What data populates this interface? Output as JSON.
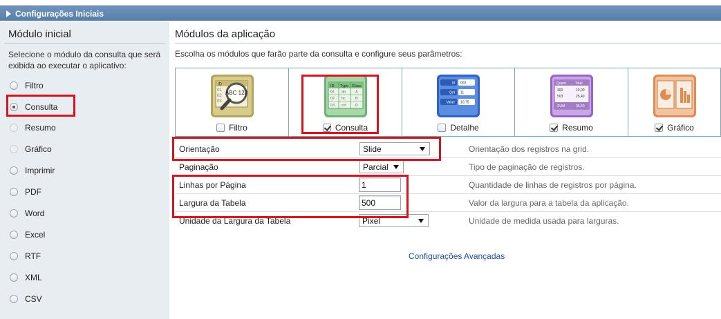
{
  "header": {
    "title": "Configurações Iniciais"
  },
  "sidebar": {
    "title": "Módulo inicial",
    "description": "Selecione o módulo da consulta que será exibida ao executar o aplicativo:",
    "options": [
      {
        "label": "Filtro",
        "state": "enabled"
      },
      {
        "label": "Consulta",
        "state": "checked"
      },
      {
        "label": "Resumo",
        "state": "disabled"
      },
      {
        "label": "Gráfico",
        "state": "disabled"
      },
      {
        "label": "Imprimir",
        "state": "enabled"
      },
      {
        "label": "PDF",
        "state": "enabled"
      },
      {
        "label": "Word",
        "state": "enabled"
      },
      {
        "label": "Excel",
        "state": "enabled"
      },
      {
        "label": "RTF",
        "state": "enabled"
      },
      {
        "label": "XML",
        "state": "enabled"
      },
      {
        "label": "CSV",
        "state": "enabled"
      }
    ]
  },
  "main": {
    "title": "Módulos da aplicação",
    "description": "Escolha os módulos que farão parte da consulta e configure seus parâmetros:",
    "modules": [
      {
        "label": "Filtro",
        "checked": false,
        "icon": "filter-icon",
        "icon_text": {
          "h1": "ID",
          "c1": "01",
          "c2": "02",
          "c3": "03",
          "magnifier": "ABC 123"
        }
      },
      {
        "label": "Consulta",
        "checked": true,
        "icon": "grid-icon",
        "icon_text": {
          "h1": "ID",
          "h2": "Type",
          "h3": "Class",
          "r1": [
            "01",
            "ab",
            "A"
          ],
          "r2": [
            "02",
            "bc",
            "B"
          ],
          "r3": [
            "03",
            "cd",
            "D"
          ]
        }
      },
      {
        "label": "Detalhe",
        "checked": false,
        "icon": "detail-icon",
        "icon_text": {
          "l1": "Id",
          "v1": "002",
          "l2": "Qnt",
          "v2": "11",
          "l3": "Value",
          "v3": "10,75"
        }
      },
      {
        "label": "Resumo",
        "checked": true,
        "icon": "summary-icon",
        "icon_text": {
          "h1": "Quant.",
          "h2": "Total",
          "r1": [
            "300",
            "10,00"
          ],
          "r2": [
            "503",
            "25,40"
          ],
          "r3": [
            "SUM",
            "35,40"
          ]
        }
      },
      {
        "label": "Gráfico",
        "checked": true,
        "icon": "chart-icon"
      }
    ],
    "params": [
      {
        "label": "Orientação",
        "type": "select",
        "value": "Slide",
        "description": "Orientação dos registros na grid."
      },
      {
        "label": "Paginação",
        "type": "select",
        "value": "Parcial",
        "description": "Tipo de paginação de registros."
      },
      {
        "label": "Linhas por Página",
        "type": "input",
        "value": "1",
        "description": "Quantidade de linhas de registros por página."
      },
      {
        "label": "Largura da Tabela",
        "type": "input",
        "value": "500",
        "description": "Valor da largura para a tabela da aplicação."
      },
      {
        "label": "Unidade da Largura da Tabela",
        "type": "select",
        "value": "Pixel",
        "description": "Unidade de medida usada para larguras."
      }
    ],
    "advanced_link": "Configurações Avançadas"
  },
  "colors": {
    "header": "#5b82ad",
    "highlight": "#d4141e",
    "link": "#1f4f9b"
  }
}
